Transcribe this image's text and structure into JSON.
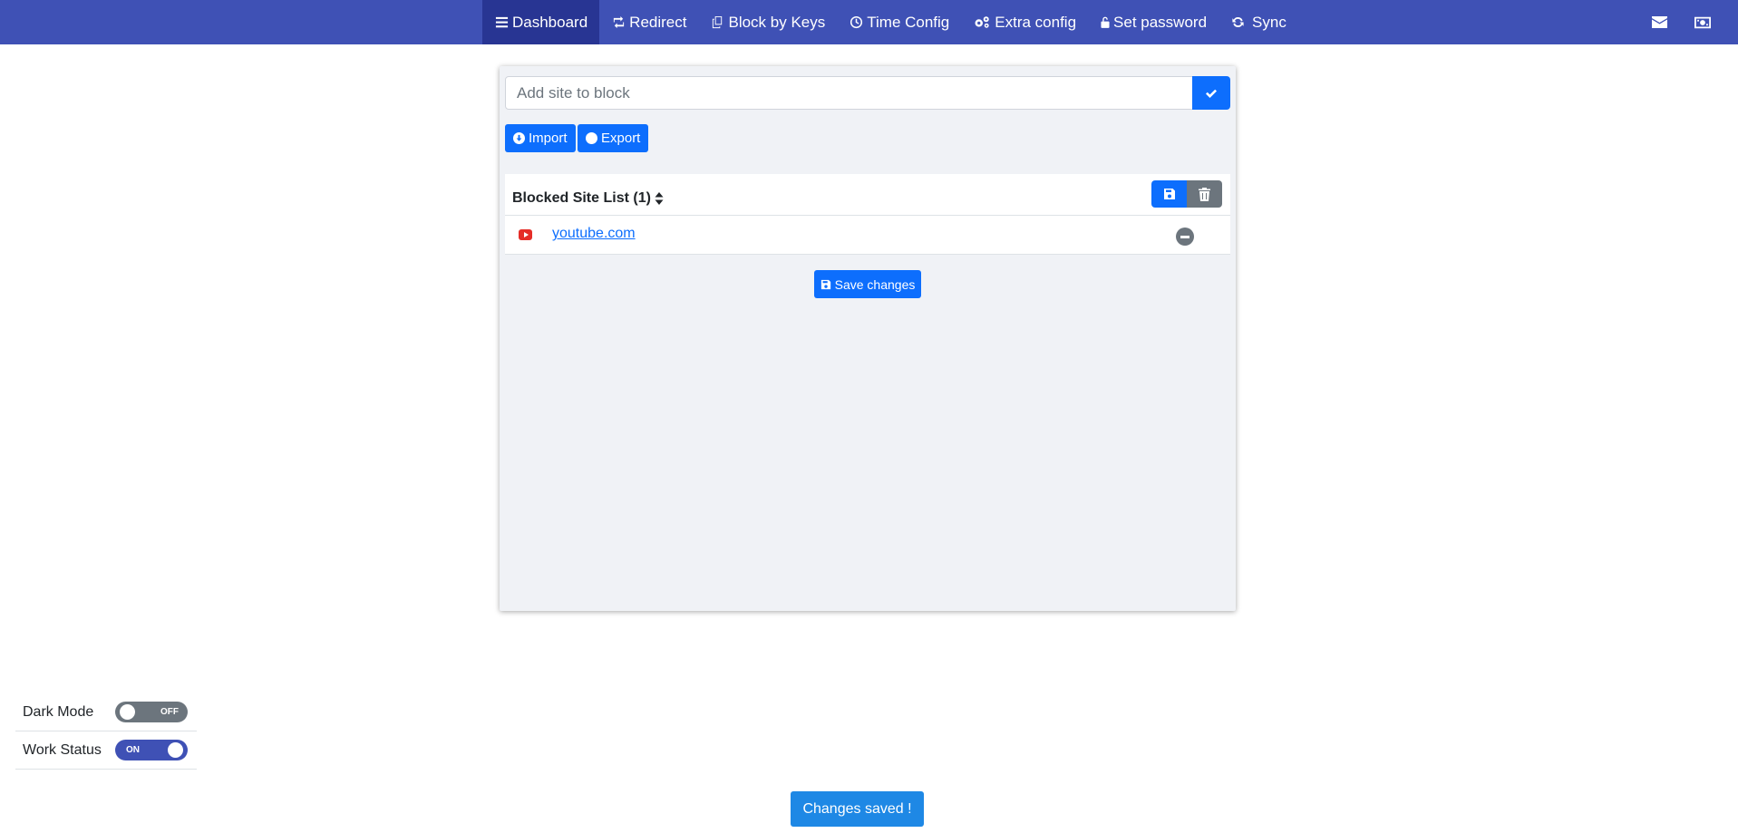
{
  "nav": {
    "items": [
      {
        "label": "Dashboard",
        "icon": "bars-icon",
        "active": true
      },
      {
        "label": "Redirect",
        "icon": "retweet-icon",
        "active": false
      },
      {
        "label": "Block by Keys",
        "icon": "copy-icon",
        "active": false
      },
      {
        "label": "Time Config",
        "icon": "clock-icon",
        "active": false
      },
      {
        "label": "Extra config",
        "icon": "cogs-icon",
        "active": false
      },
      {
        "label": "Set password",
        "icon": "unlock-icon",
        "active": false
      },
      {
        "label": "Sync",
        "icon": "refresh-icon",
        "active": false
      }
    ],
    "right_icons": [
      "envelope-icon",
      "money-icon"
    ]
  },
  "add_site": {
    "placeholder": "Add site to block"
  },
  "buttons": {
    "import_label": "Import",
    "export_label": "Export",
    "save_changes_label": "Save changes"
  },
  "blocked_list": {
    "title": "Blocked Site List (1)",
    "items": [
      {
        "site": "youtube.com",
        "favicon": "youtube-icon"
      }
    ]
  },
  "settings": {
    "dark_mode": {
      "label": "Dark Mode",
      "state": "OFF"
    },
    "work_status": {
      "label": "Work Status",
      "state": "ON"
    }
  },
  "toast": {
    "message": "Changes saved !"
  },
  "colors": {
    "navbar": "#3f51b5",
    "nav_active": "#283593",
    "primary": "#0d6efd",
    "secondary": "#6c757d",
    "toast": "#1e88e5"
  }
}
